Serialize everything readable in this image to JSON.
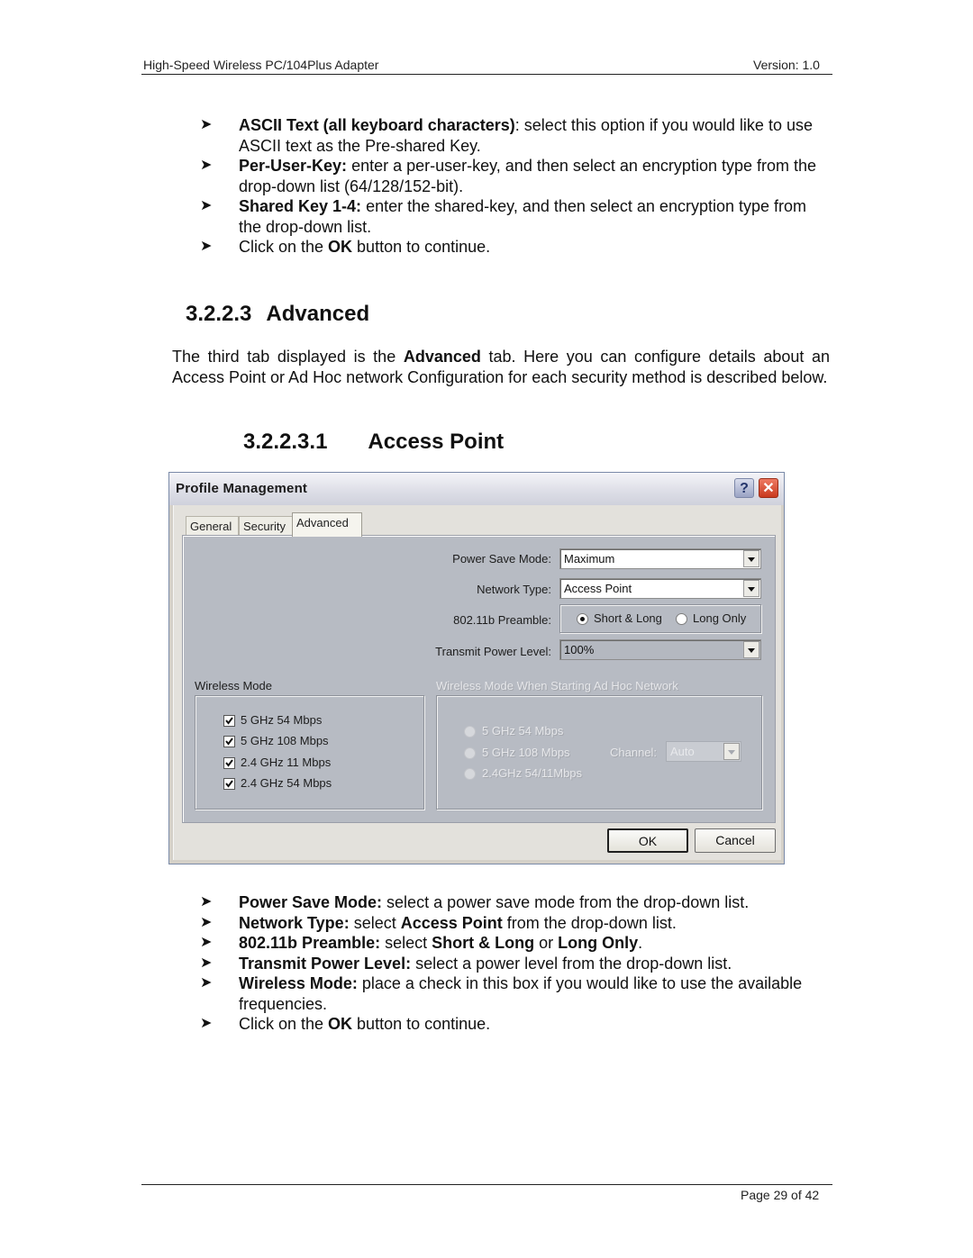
{
  "page_header": {
    "title": "High-Speed Wireless PC/104Plus Adapter",
    "version": "Version: 1.0"
  },
  "intro_bullets": [
    {
      "bold": "ASCII Text (all keyboard characters)",
      "text": ": select this option if you would like to use ASCII text as the Pre-shared Key."
    },
    {
      "bold": "Per-User-Key:",
      "text": " enter a per-user-key, and then select an encryption type from the drop-down list (64/128/152-bit)."
    },
    {
      "bold": "Shared Key 1-4:",
      "text": " enter the shared-key, and then select an encryption type from the drop-down list."
    },
    {
      "pre": "Click on the ",
      "bold": "OK",
      "text": " button to continue."
    }
  ],
  "section": {
    "number": "3.2.2.3",
    "title": "Advanced",
    "para_pre": "The third tab displayed is the ",
    "para_bold": "Advanced",
    "para_post": " tab. Here you can configure details about an Access Point or Ad Hoc network Configuration for each security method is described below."
  },
  "subsection": {
    "number": "3.2.2.3.1",
    "title": "Access Point"
  },
  "dialog": {
    "title": "Profile Management",
    "help_icon": "?",
    "close_icon": "✕",
    "tabs": [
      {
        "label": "General",
        "active": false
      },
      {
        "label": "Security",
        "active": false
      },
      {
        "label": "Advanced",
        "active": true
      }
    ],
    "power_save_mode": {
      "label": "Power Save Mode:",
      "value": "Maximum"
    },
    "network_type": {
      "label": "Network Type:",
      "value": "Access Point"
    },
    "preamble": {
      "label": "802.11b Preamble:",
      "options": [
        {
          "label": "Short & Long",
          "checked": true
        },
        {
          "label": "Long Only",
          "checked": false
        }
      ]
    },
    "transmit_power": {
      "label": "Transmit Power Level:",
      "value": "100%"
    },
    "wireless_mode": {
      "label": "Wireless Mode",
      "options": [
        {
          "label": "5 GHz 54 Mbps",
          "checked": true
        },
        {
          "label": "5 GHz 108 Mbps",
          "checked": true
        },
        {
          "label": "2.4 GHz 11 Mbps",
          "checked": true
        },
        {
          "label": "2.4 GHz 54 Mbps",
          "checked": true
        }
      ]
    },
    "adhoc_mode": {
      "label": "Wireless Mode When Starting Ad Hoc Network",
      "options": [
        {
          "label": "5 GHz 54 Mbps"
        },
        {
          "label": "5 GHz 108 Mbps"
        },
        {
          "label": "2.4GHz 54/11Mbps"
        }
      ],
      "channel_label": "Channel:",
      "channel_value": "Auto"
    },
    "ok_label": "OK",
    "cancel_label": "Cancel"
  },
  "after_bullets": [
    {
      "bold": "Power Save Mode:",
      "text": " select a power save mode from the drop-down list."
    },
    {
      "bold": "Network Type:",
      "text": " select ",
      "bold2": "Access Point",
      "text2": " from the drop-down list."
    },
    {
      "bold": "802.11b Preamble:",
      "text": " select ",
      "bold2": "Short & Long",
      "text2": " or ",
      "bold3": "Long Only",
      "text3": "."
    },
    {
      "bold": "Transmit Power Level:",
      "text": " select a power level from the drop-down list."
    },
    {
      "bold": "Wireless Mode:",
      "text": " place a check in this box if you would like to use the available frequencies."
    },
    {
      "pre": "Click on the ",
      "bold": "OK",
      "text": " button to continue."
    }
  ],
  "bullet_glyph": "➤",
  "footer": {
    "page": "Page 29 of 42"
  }
}
